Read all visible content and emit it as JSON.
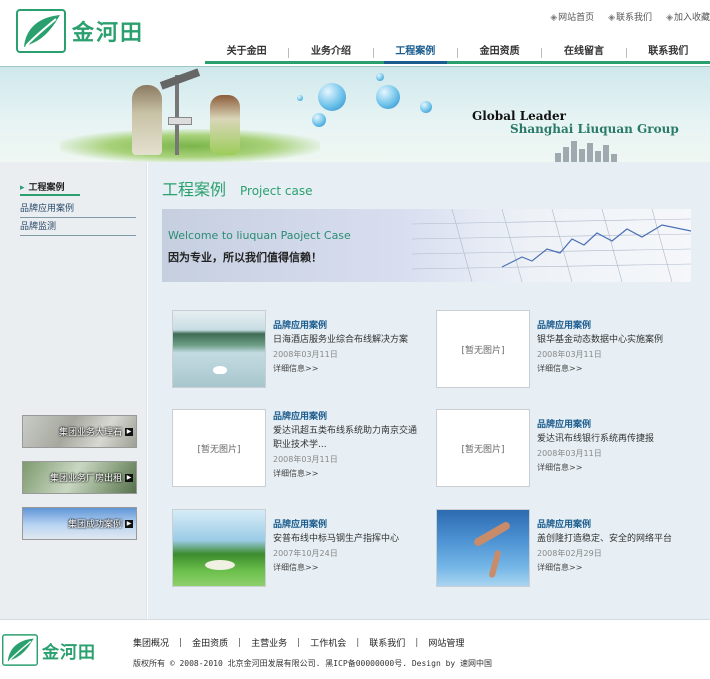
{
  "brand": {
    "logo_text": "金河田"
  },
  "top_links": [
    {
      "label": "网站首页",
      "icon": "diamond-bullet-icon"
    },
    {
      "label": "联系我们",
      "icon": "diamond-bullet-icon"
    },
    {
      "label": "加入收藏",
      "icon": "diamond-bullet-icon"
    }
  ],
  "nav": {
    "items": [
      "关于金田",
      "业务介绍",
      "工程案例",
      "金田资质",
      "在线留言",
      "联系我们"
    ],
    "active": "工程案例"
  },
  "banner": {
    "tagline_line1": "Global Leader",
    "tagline_line2": "Shanghai Liuquan Group"
  },
  "sidebar": {
    "title": "工程案例",
    "links": [
      "品牌应用案例",
      "品牌监测"
    ],
    "banners": [
      "集团业务大理石",
      "集团业务厂房出租",
      "集团成功案例"
    ]
  },
  "main": {
    "heading_cn": "工程案例",
    "heading_en": "Project case",
    "welcome_en": "Welcome to liuquan Paoject Case",
    "welcome_cn": "因为专业，所以我们值得信赖！",
    "cases": [
      {
        "category": "品牌应用案例",
        "desc": "日海酒店服务业综合布线解决方案",
        "date": "2008年03月11日",
        "more": "详细信息>>",
        "image": "lake-photo",
        "no_image_text": ""
      },
      {
        "category": "品牌应用案例",
        "desc": "银华基金动态数据中心实施案例",
        "date": "2008年03月11日",
        "more": "详细信息>>",
        "image": "none",
        "no_image_text": "[暂无图片]"
      },
      {
        "category": "品牌应用案例",
        "desc": "爱达讯超五类布线系统助力南京交通职业技术学...",
        "date": "2008年03月11日",
        "more": "详细信息>>",
        "image": "none",
        "no_image_text": "[暂无图片]"
      },
      {
        "category": "品牌应用案例",
        "desc": "爱达讯布线银行系统再传捷报",
        "date": "2008年03月11日",
        "more": "详细信息>>",
        "image": "none",
        "no_image_text": "[暂无图片]"
      },
      {
        "category": "品牌应用案例",
        "desc": "安普布线中标马钢生产指挥中心",
        "date": "2007年10月24日",
        "more": "详细信息>>",
        "image": "golf-photo",
        "no_image_text": ""
      },
      {
        "category": "品牌应用案例",
        "desc": "盖创隆打造稳定、安全的网络平台",
        "date": "2008年02月29日",
        "more": "详细信息>>",
        "image": "diver-photo",
        "no_image_text": ""
      }
    ]
  },
  "footer": {
    "links": [
      "集团概况",
      "金田资质",
      "主营业务",
      "工作机会",
      "联系我们",
      "网站管理"
    ],
    "copyright": "版权所有 © 2008-2010 北京金河田发展有限公司. 黑ICP备00000000号. Design by 速网中国"
  },
  "colors": {
    "brand_green": "#2aa06e",
    "nav_active": "#1c5d8f",
    "main_bg": "#e7eff4",
    "sidebar_bg": "#eaeef0"
  }
}
